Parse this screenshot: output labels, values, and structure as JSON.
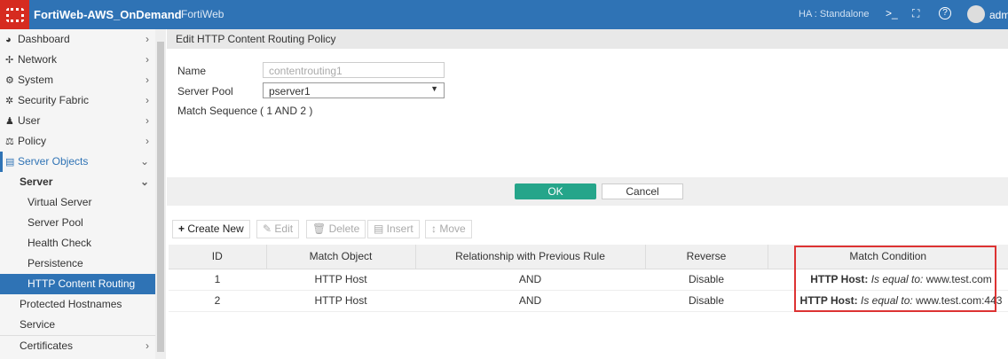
{
  "header": {
    "title": "FortiWeb-AWS_OnDemand",
    "product": "FortiWeb",
    "ha": "HA : Standalone",
    "cli_icon": ">_",
    "fullscreen_icon": "⛶",
    "help_icon": "?",
    "user": "adm"
  },
  "sidebar": {
    "items": [
      {
        "label": "Dashboard",
        "icon": "◕"
      },
      {
        "label": "Network",
        "icon": "✢"
      },
      {
        "label": "System",
        "icon": "⚙"
      },
      {
        "label": "Security Fabric",
        "icon": "✲"
      },
      {
        "label": "User",
        "icon": "♟"
      },
      {
        "label": "Policy",
        "icon": "⚖"
      },
      {
        "label": "Server Objects",
        "icon": "▤"
      }
    ],
    "server": "Server",
    "server_items": [
      "Virtual Server",
      "Server Pool",
      "Health Check",
      "Persistence",
      "HTTP Content Routing"
    ],
    "others": [
      "Protected Hostnames",
      "Service"
    ],
    "certificates": "Certificates"
  },
  "page": {
    "title": "Edit HTTP Content Routing Policy",
    "name_label": "Name",
    "name_value": "contentrouting1",
    "pool_label": "Server Pool",
    "pool_value": "pserver1",
    "seq_label": "Match Sequence",
    "seq_value": "( 1 AND 2 )",
    "ok": "OK",
    "cancel": "Cancel"
  },
  "toolbar": {
    "create": "Create New",
    "edit": "Edit",
    "delete": "Delete",
    "insert": "Insert",
    "move": "Move"
  },
  "table": {
    "headers": [
      "ID",
      "Match Object",
      "Relationship with Previous Rule",
      "Reverse",
      "Match Condition"
    ],
    "rows": [
      {
        "id": "1",
        "object": "HTTP Host",
        "rel": "AND",
        "reverse": "Disable",
        "cond_key": "HTTP Host:",
        "cond_op": "Is equal to:",
        "cond_val": "www.test.com"
      },
      {
        "id": "2",
        "object": "HTTP Host",
        "rel": "AND",
        "reverse": "Disable",
        "cond_key": "HTTP Host:",
        "cond_op": "Is equal to:",
        "cond_val": "www.test.com:443"
      }
    ]
  }
}
